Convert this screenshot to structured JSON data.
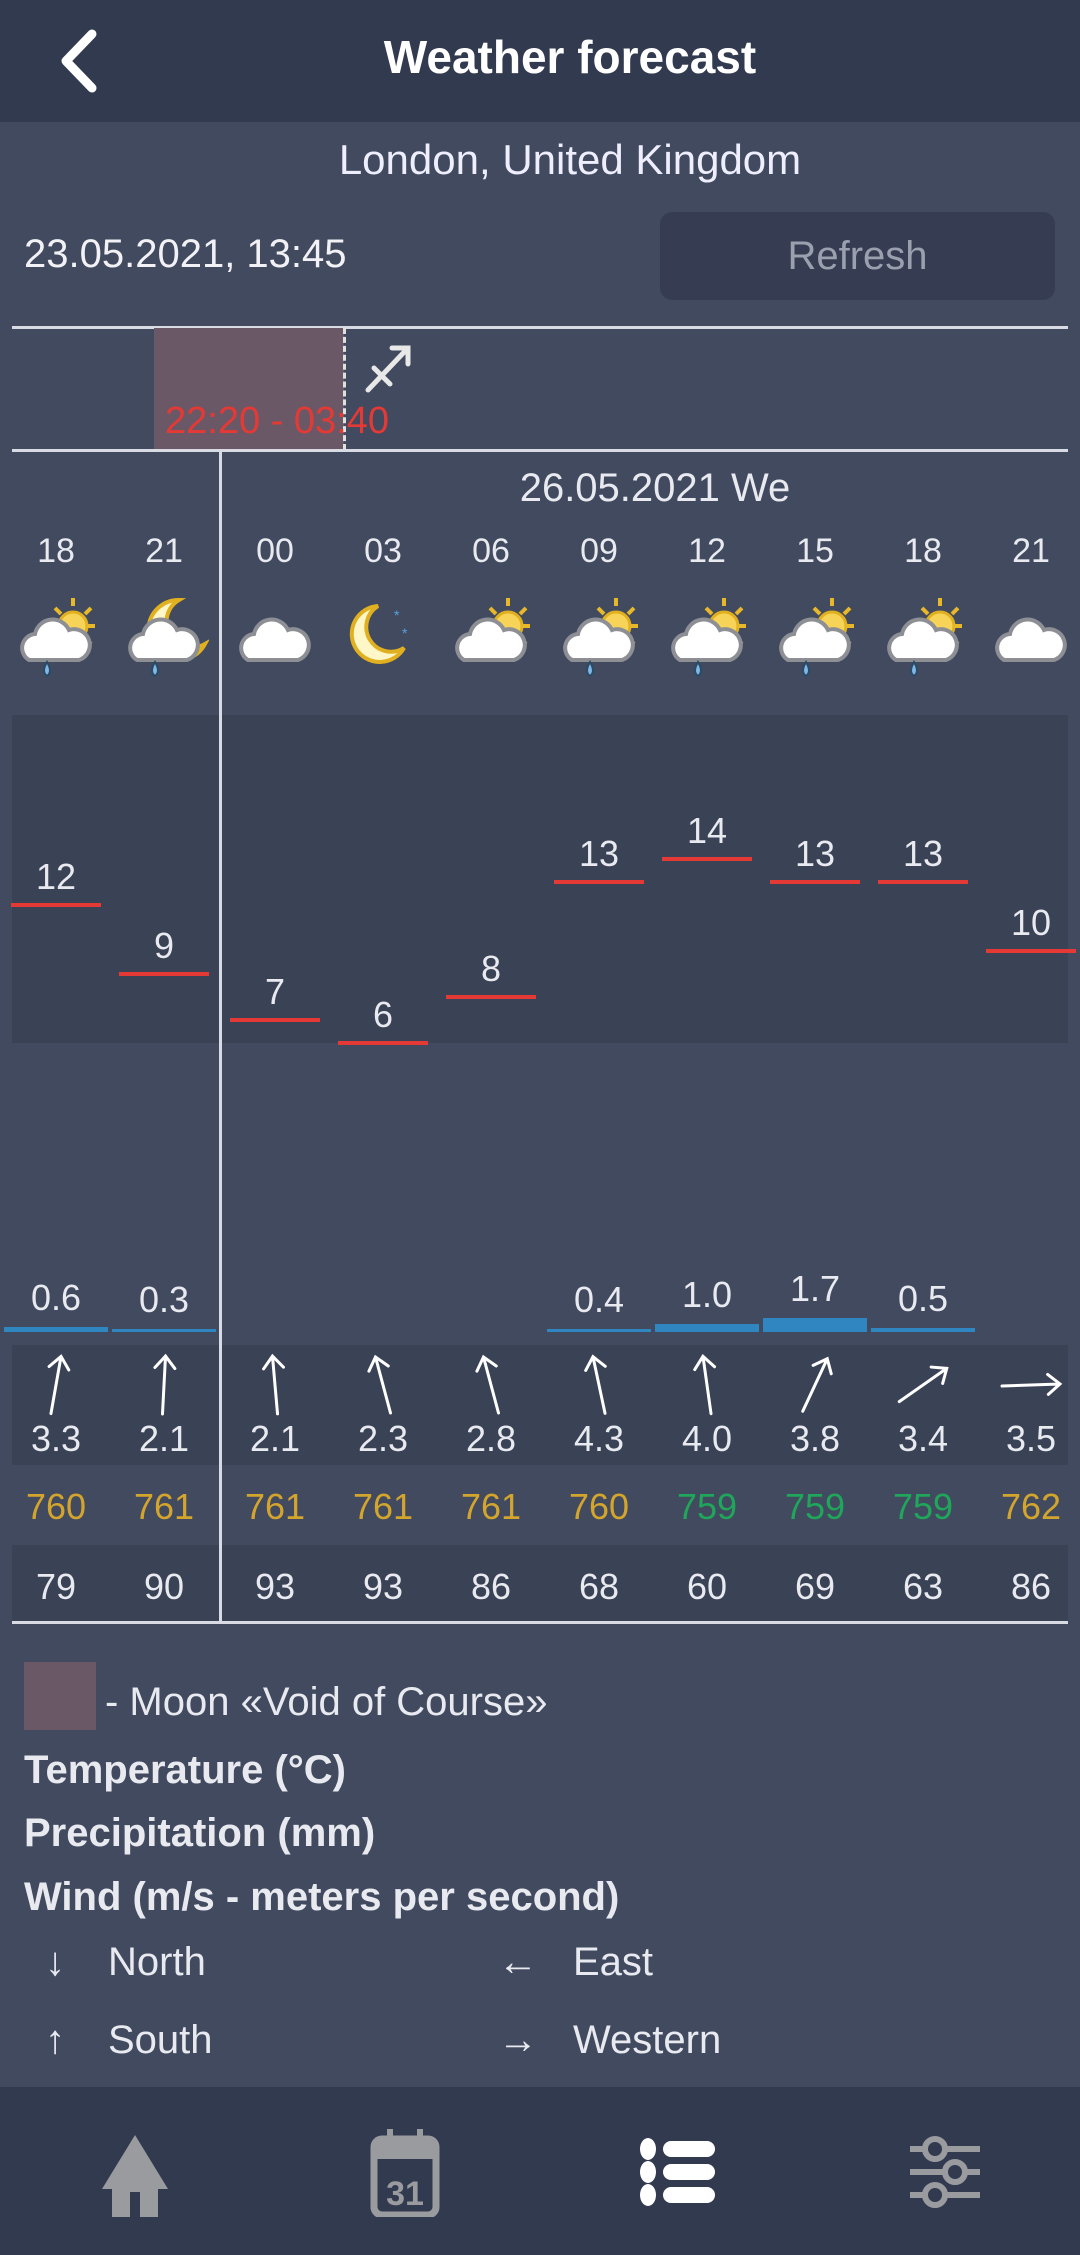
{
  "header": {
    "title": "Weather forecast",
    "back_icon": "chevron-left-icon"
  },
  "location": "London, United Kingdom",
  "datetime": "23.05.2021, 13:45",
  "refresh_label": "Refresh",
  "void_of_course": {
    "time": "22:20 - 03:40",
    "sign_icon": "sagittarius-icon",
    "color": "#6b5866"
  },
  "day_label": "26.05.2021 We",
  "columns": [
    {
      "hour": "18",
      "icon": "cloud-sun-rain",
      "temp": 12,
      "precip": "0.6",
      "wind": "3.3",
      "wind_angle": 10,
      "pressure": "760",
      "humidity": "79"
    },
    {
      "hour": "21",
      "icon": "cloud-moon-rain",
      "temp": 9,
      "precip": "0.3",
      "wind": "2.1",
      "wind_angle": 3,
      "pressure": "761",
      "humidity": "90"
    },
    {
      "hour": "00",
      "icon": "cloud",
      "temp": 7,
      "precip": null,
      "wind": "2.1",
      "wind_angle": -5,
      "pressure": "761",
      "humidity": "93"
    },
    {
      "hour": "03",
      "icon": "moon-stars",
      "temp": 6,
      "precip": null,
      "wind": "2.3",
      "wind_angle": -15,
      "pressure": "761",
      "humidity": "93"
    },
    {
      "hour": "06",
      "icon": "cloud-sun",
      "temp": 8,
      "precip": null,
      "wind": "2.8",
      "wind_angle": -15,
      "pressure": "761",
      "humidity": "86"
    },
    {
      "hour": "09",
      "icon": "cloud-sun-rain",
      "temp": 13,
      "precip": "0.4",
      "wind": "4.3",
      "wind_angle": -12,
      "pressure": "760",
      "humidity": "68"
    },
    {
      "hour": "12",
      "icon": "cloud-sun-rain",
      "temp": 14,
      "precip": "1.0",
      "wind": "4.0",
      "wind_angle": -8,
      "pressure": "759",
      "humidity": "60"
    },
    {
      "hour": "15",
      "icon": "cloud-sun-rain",
      "temp": 13,
      "precip": "1.7",
      "wind": "3.8",
      "wind_angle": 25,
      "pressure": "759",
      "humidity": "69"
    },
    {
      "hour": "18",
      "icon": "cloud-sun-rain",
      "temp": 13,
      "precip": "0.5",
      "wind": "3.4",
      "wind_angle": 55,
      "pressure": "759",
      "humidity": "63"
    },
    {
      "hour": "21",
      "icon": "cloud",
      "temp": 10,
      "precip": null,
      "wind": "3.5",
      "wind_angle": 88,
      "pressure": "762",
      "humidity": "86"
    }
  ],
  "colors": {
    "temp_line": "#e53935",
    "precip_bar": "#2f86c1",
    "pressure_normal": "#d4a52c",
    "pressure_low": "#1fa65a"
  },
  "legend": {
    "voc": "- Moon «Void of Course»",
    "temperature": "Temperature (°C)",
    "precipitation": "Precipitation (mm)",
    "wind": "Wind (m/s - meters per second)",
    "directions": [
      {
        "arrow": "↓",
        "label": "North"
      },
      {
        "arrow": "←",
        "label": "East"
      },
      {
        "arrow": "↑",
        "label": "South"
      },
      {
        "arrow": "→",
        "label": "Western"
      }
    ]
  },
  "nav": [
    {
      "icon": "home-icon",
      "active": false
    },
    {
      "icon": "calendar-icon",
      "active": false,
      "text": "31"
    },
    {
      "icon": "list-icon",
      "active": true
    },
    {
      "icon": "sliders-icon",
      "active": false
    }
  ]
}
